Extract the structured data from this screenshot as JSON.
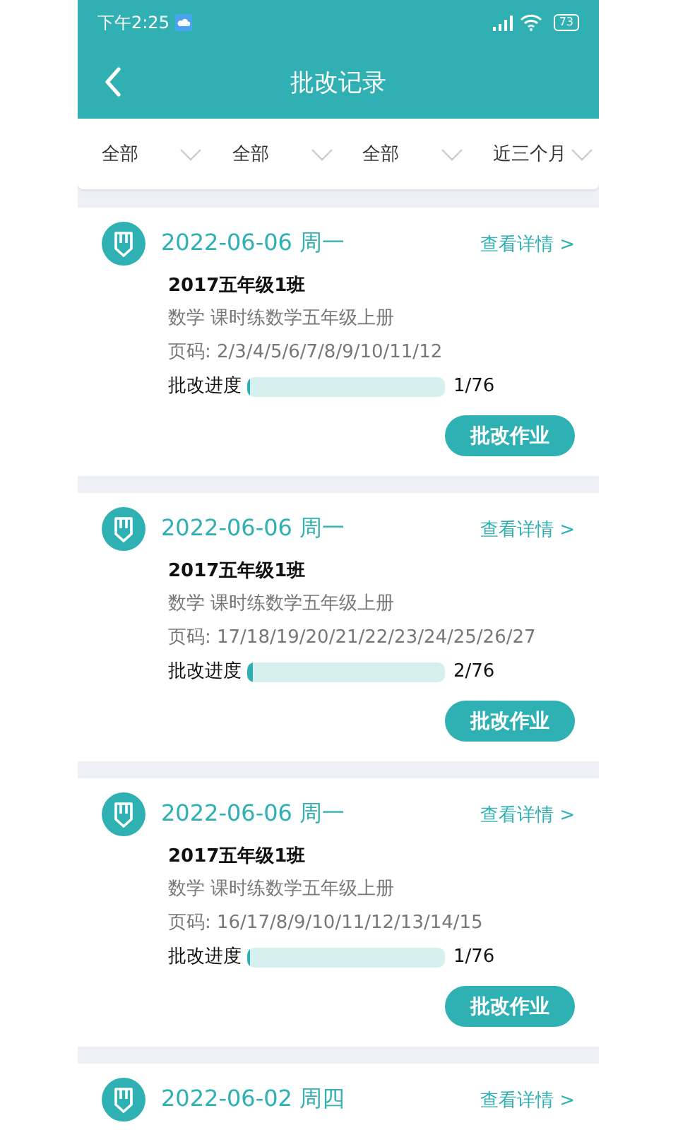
{
  "status_bar": {
    "time": "下午2:25",
    "battery": "73"
  },
  "header": {
    "title": "批改记录"
  },
  "filters": [
    {
      "label": "全部"
    },
    {
      "label": "全部"
    },
    {
      "label": "全部"
    },
    {
      "label": "近三个月"
    }
  ],
  "records": [
    {
      "date": "2022-06-06 周一",
      "detail_link": "查看详情 >",
      "class_name": "2017五年级1班",
      "book": "数学 课时练数学五年级上册",
      "pages": "页码: 2/3/4/5/6/7/8/9/10/11/12",
      "progress_label": "批改进度",
      "level": 0.013,
      "progress_text": "1/76",
      "action": "批改作业"
    },
    {
      "date": "2022-06-06 周一",
      "detail_link": "查看详情 >",
      "class_name": "2017五年级1班",
      "book": "数学 课时练数学五年级上册",
      "pages": "页码: 17/18/19/20/21/22/23/24/25/26/27",
      "progress_label": "批改进度",
      "level": 0.026,
      "progress_text": "2/76",
      "action": "批改作业"
    },
    {
      "date": "2022-06-06 周一",
      "detail_link": "查看详情 >",
      "class_name": "2017五年级1班",
      "book": "数学 课时练数学五年级上册",
      "pages": "页码: 16/17/8/9/10/11/12/13/14/15",
      "progress_label": "批改进度",
      "level": 0.013,
      "progress_text": "1/76",
      "action": "批改作业"
    },
    {
      "date": "2022-06-02 周四",
      "detail_link": "查看详情 >"
    }
  ]
}
